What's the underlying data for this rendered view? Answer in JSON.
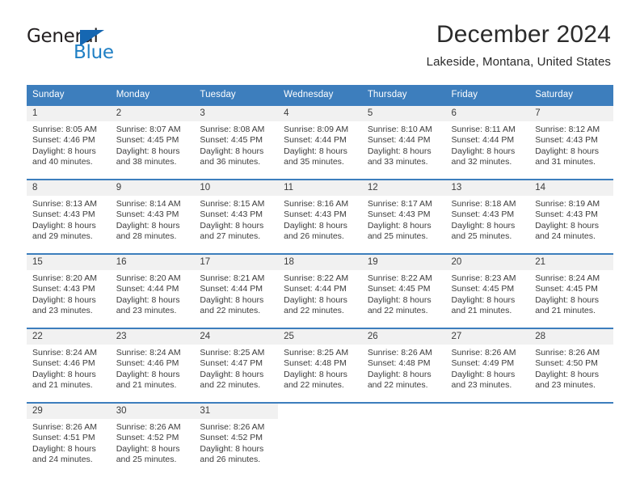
{
  "logo": {
    "word_top": "General",
    "word_bottom": "Blue",
    "triangle_color": "#1667b2",
    "text_color_top": "#231f20",
    "text_color_bottom": "#1f7fc4"
  },
  "header": {
    "title": "December 2024",
    "subtitle": "Lakeside, Montana, United States"
  },
  "theme": {
    "header_bar": "#3d7ebd",
    "daynum_band": "#f1f1f1",
    "text": "#3c3c3c"
  },
  "weekday_headers": [
    "Sunday",
    "Monday",
    "Tuesday",
    "Wednesday",
    "Thursday",
    "Friday",
    "Saturday"
  ],
  "weeks": [
    [
      {
        "day": "1",
        "sunrise": "Sunrise: 8:05 AM",
        "sunset": "Sunset: 4:46 PM",
        "daylight_line1": "Daylight: 8 hours",
        "daylight_line2": "and 40 minutes."
      },
      {
        "day": "2",
        "sunrise": "Sunrise: 8:07 AM",
        "sunset": "Sunset: 4:45 PM",
        "daylight_line1": "Daylight: 8 hours",
        "daylight_line2": "and 38 minutes."
      },
      {
        "day": "3",
        "sunrise": "Sunrise: 8:08 AM",
        "sunset": "Sunset: 4:45 PM",
        "daylight_line1": "Daylight: 8 hours",
        "daylight_line2": "and 36 minutes."
      },
      {
        "day": "4",
        "sunrise": "Sunrise: 8:09 AM",
        "sunset": "Sunset: 4:44 PM",
        "daylight_line1": "Daylight: 8 hours",
        "daylight_line2": "and 35 minutes."
      },
      {
        "day": "5",
        "sunrise": "Sunrise: 8:10 AM",
        "sunset": "Sunset: 4:44 PM",
        "daylight_line1": "Daylight: 8 hours",
        "daylight_line2": "and 33 minutes."
      },
      {
        "day": "6",
        "sunrise": "Sunrise: 8:11 AM",
        "sunset": "Sunset: 4:44 PM",
        "daylight_line1": "Daylight: 8 hours",
        "daylight_line2": "and 32 minutes."
      },
      {
        "day": "7",
        "sunrise": "Sunrise: 8:12 AM",
        "sunset": "Sunset: 4:43 PM",
        "daylight_line1": "Daylight: 8 hours",
        "daylight_line2": "and 31 minutes."
      }
    ],
    [
      {
        "day": "8",
        "sunrise": "Sunrise: 8:13 AM",
        "sunset": "Sunset: 4:43 PM",
        "daylight_line1": "Daylight: 8 hours",
        "daylight_line2": "and 29 minutes."
      },
      {
        "day": "9",
        "sunrise": "Sunrise: 8:14 AM",
        "sunset": "Sunset: 4:43 PM",
        "daylight_line1": "Daylight: 8 hours",
        "daylight_line2": "and 28 minutes."
      },
      {
        "day": "10",
        "sunrise": "Sunrise: 8:15 AM",
        "sunset": "Sunset: 4:43 PM",
        "daylight_line1": "Daylight: 8 hours",
        "daylight_line2": "and 27 minutes."
      },
      {
        "day": "11",
        "sunrise": "Sunrise: 8:16 AM",
        "sunset": "Sunset: 4:43 PM",
        "daylight_line1": "Daylight: 8 hours",
        "daylight_line2": "and 26 minutes."
      },
      {
        "day": "12",
        "sunrise": "Sunrise: 8:17 AM",
        "sunset": "Sunset: 4:43 PM",
        "daylight_line1": "Daylight: 8 hours",
        "daylight_line2": "and 25 minutes."
      },
      {
        "day": "13",
        "sunrise": "Sunrise: 8:18 AM",
        "sunset": "Sunset: 4:43 PM",
        "daylight_line1": "Daylight: 8 hours",
        "daylight_line2": "and 25 minutes."
      },
      {
        "day": "14",
        "sunrise": "Sunrise: 8:19 AM",
        "sunset": "Sunset: 4:43 PM",
        "daylight_line1": "Daylight: 8 hours",
        "daylight_line2": "and 24 minutes."
      }
    ],
    [
      {
        "day": "15",
        "sunrise": "Sunrise: 8:20 AM",
        "sunset": "Sunset: 4:43 PM",
        "daylight_line1": "Daylight: 8 hours",
        "daylight_line2": "and 23 minutes."
      },
      {
        "day": "16",
        "sunrise": "Sunrise: 8:20 AM",
        "sunset": "Sunset: 4:44 PM",
        "daylight_line1": "Daylight: 8 hours",
        "daylight_line2": "and 23 minutes."
      },
      {
        "day": "17",
        "sunrise": "Sunrise: 8:21 AM",
        "sunset": "Sunset: 4:44 PM",
        "daylight_line1": "Daylight: 8 hours",
        "daylight_line2": "and 22 minutes."
      },
      {
        "day": "18",
        "sunrise": "Sunrise: 8:22 AM",
        "sunset": "Sunset: 4:44 PM",
        "daylight_line1": "Daylight: 8 hours",
        "daylight_line2": "and 22 minutes."
      },
      {
        "day": "19",
        "sunrise": "Sunrise: 8:22 AM",
        "sunset": "Sunset: 4:45 PM",
        "daylight_line1": "Daylight: 8 hours",
        "daylight_line2": "and 22 minutes."
      },
      {
        "day": "20",
        "sunrise": "Sunrise: 8:23 AM",
        "sunset": "Sunset: 4:45 PM",
        "daylight_line1": "Daylight: 8 hours",
        "daylight_line2": "and 21 minutes."
      },
      {
        "day": "21",
        "sunrise": "Sunrise: 8:24 AM",
        "sunset": "Sunset: 4:45 PM",
        "daylight_line1": "Daylight: 8 hours",
        "daylight_line2": "and 21 minutes."
      }
    ],
    [
      {
        "day": "22",
        "sunrise": "Sunrise: 8:24 AM",
        "sunset": "Sunset: 4:46 PM",
        "daylight_line1": "Daylight: 8 hours",
        "daylight_line2": "and 21 minutes."
      },
      {
        "day": "23",
        "sunrise": "Sunrise: 8:24 AM",
        "sunset": "Sunset: 4:46 PM",
        "daylight_line1": "Daylight: 8 hours",
        "daylight_line2": "and 21 minutes."
      },
      {
        "day": "24",
        "sunrise": "Sunrise: 8:25 AM",
        "sunset": "Sunset: 4:47 PM",
        "daylight_line1": "Daylight: 8 hours",
        "daylight_line2": "and 22 minutes."
      },
      {
        "day": "25",
        "sunrise": "Sunrise: 8:25 AM",
        "sunset": "Sunset: 4:48 PM",
        "daylight_line1": "Daylight: 8 hours",
        "daylight_line2": "and 22 minutes."
      },
      {
        "day": "26",
        "sunrise": "Sunrise: 8:26 AM",
        "sunset": "Sunset: 4:48 PM",
        "daylight_line1": "Daylight: 8 hours",
        "daylight_line2": "and 22 minutes."
      },
      {
        "day": "27",
        "sunrise": "Sunrise: 8:26 AM",
        "sunset": "Sunset: 4:49 PM",
        "daylight_line1": "Daylight: 8 hours",
        "daylight_line2": "and 23 minutes."
      },
      {
        "day": "28",
        "sunrise": "Sunrise: 8:26 AM",
        "sunset": "Sunset: 4:50 PM",
        "daylight_line1": "Daylight: 8 hours",
        "daylight_line2": "and 23 minutes."
      }
    ],
    [
      {
        "day": "29",
        "sunrise": "Sunrise: 8:26 AM",
        "sunset": "Sunset: 4:51 PM",
        "daylight_line1": "Daylight: 8 hours",
        "daylight_line2": "and 24 minutes."
      },
      {
        "day": "30",
        "sunrise": "Sunrise: 8:26 AM",
        "sunset": "Sunset: 4:52 PM",
        "daylight_line1": "Daylight: 8 hours",
        "daylight_line2": "and 25 minutes."
      },
      {
        "day": "31",
        "sunrise": "Sunrise: 8:26 AM",
        "sunset": "Sunset: 4:52 PM",
        "daylight_line1": "Daylight: 8 hours",
        "daylight_line2": "and 26 minutes."
      },
      {
        "day": "",
        "sunrise": "",
        "sunset": "",
        "daylight_line1": "",
        "daylight_line2": ""
      },
      {
        "day": "",
        "sunrise": "",
        "sunset": "",
        "daylight_line1": "",
        "daylight_line2": ""
      },
      {
        "day": "",
        "sunrise": "",
        "sunset": "",
        "daylight_line1": "",
        "daylight_line2": ""
      },
      {
        "day": "",
        "sunrise": "",
        "sunset": "",
        "daylight_line1": "",
        "daylight_line2": ""
      }
    ]
  ]
}
